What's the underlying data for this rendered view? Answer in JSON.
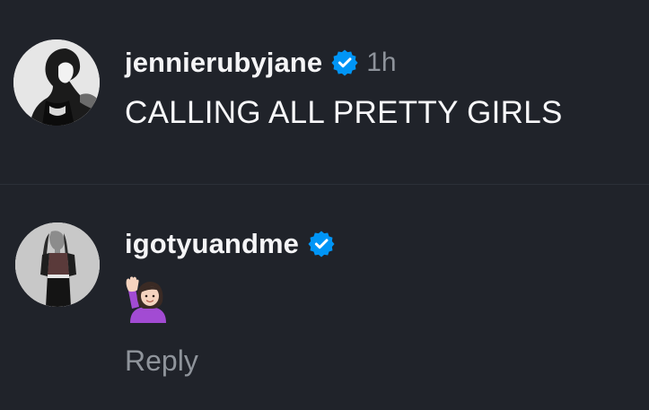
{
  "comments": [
    {
      "username": "jennierubyjane",
      "verified": true,
      "timestamp": "1h",
      "text": "CALLING ALL PRETTY GIRLS"
    },
    {
      "username": "igotyuandme",
      "verified": true,
      "emoji": "🙋🏻‍♀️",
      "reply_label": "Reply"
    }
  ],
  "colors": {
    "background": "#20232a",
    "verified_badge": "#0095f6",
    "secondary_text": "#8e939b"
  },
  "icons": {
    "verified": "verified-badge-icon"
  }
}
